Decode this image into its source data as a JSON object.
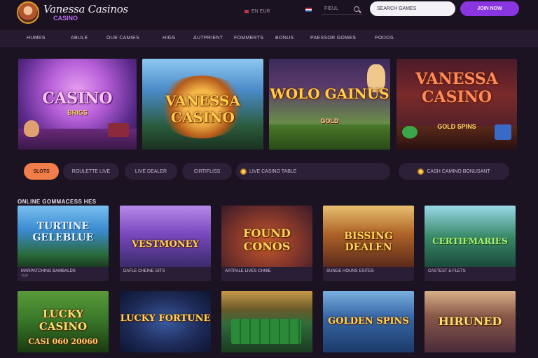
{
  "header": {
    "brand_title": "Vanessa Casinos",
    "brand_sub": "CASINO",
    "lang_label": "EN EUR",
    "header_search_label": "FIEUL",
    "main_search_placeholder": "SEARCH GAMES",
    "cta_label": "JOIN NOW"
  },
  "nav": {
    "items": [
      "HUMES",
      "ABULE",
      "OUE CAMIES",
      "HIGS",
      "AUTPRIENT",
      "FOMMERTS",
      "BONUS",
      "PAESSOR GOMES",
      "PODOS"
    ]
  },
  "banners": [
    {
      "title": "CASINO",
      "sub": "BRIGS",
      "accent": "#b94fd8"
    },
    {
      "title": "VANESSA CASINO",
      "sub": "",
      "accent": "#3f7fcf"
    },
    {
      "title": "WOLO GAINUS",
      "sub": "GOLD",
      "accent": "#5e8f3a"
    },
    {
      "title": "VANESSA CASINO",
      "sub": "GOLD SPINS",
      "accent": "#8a2a22"
    }
  ],
  "filters": {
    "active": "SLOTS",
    "pills": [
      "ROULETTE LIVE",
      "LIVE DEALER",
      "CIRTIFLISS",
      "LIVE CASINO TABLE",
      "CASH CAMINO BONUSANT"
    ]
  },
  "section": {
    "title": "ONLINE GOMMACESS HES"
  },
  "games_row1": [
    {
      "title": "TURTINE GELEBLUE",
      "name": "MARPATCHING BAMBALDS",
      "meta": "TOP",
      "accent": "#2a7ac0"
    },
    {
      "title": "VESTMONEY",
      "name": "DAFLE CHEINE GITS",
      "meta": "",
      "accent": "#7a4ac0"
    },
    {
      "title": "FOUND CONOS",
      "name": "ARTPALE LIVES CHNIE",
      "meta": "",
      "accent": "#8a3a2a"
    },
    {
      "title": "BISSING DEALEN",
      "name": "SUNGE HOUNS ESITES",
      "meta": "",
      "accent": "#b06428"
    },
    {
      "title": "CERTIFMARIES",
      "name": "CASTEST & FLETS",
      "meta": "",
      "accent": "#3a8a6a"
    }
  ],
  "games_row2": [
    {
      "title": "LUCKY CASINO",
      "name": "CASI 060 20060",
      "accent": "#3a7a2a"
    },
    {
      "title": "LUCKY FORTUNE",
      "name": "",
      "accent": "#1e2c5a"
    },
    {
      "title": "",
      "name": "",
      "accent": "#2f6a3a"
    },
    {
      "title": "GOLDEN SPINS",
      "name": "",
      "accent": "#1a3a6a"
    },
    {
      "title": "HIRUNED",
      "name": "",
      "accent": "#6a3a4a"
    }
  ]
}
